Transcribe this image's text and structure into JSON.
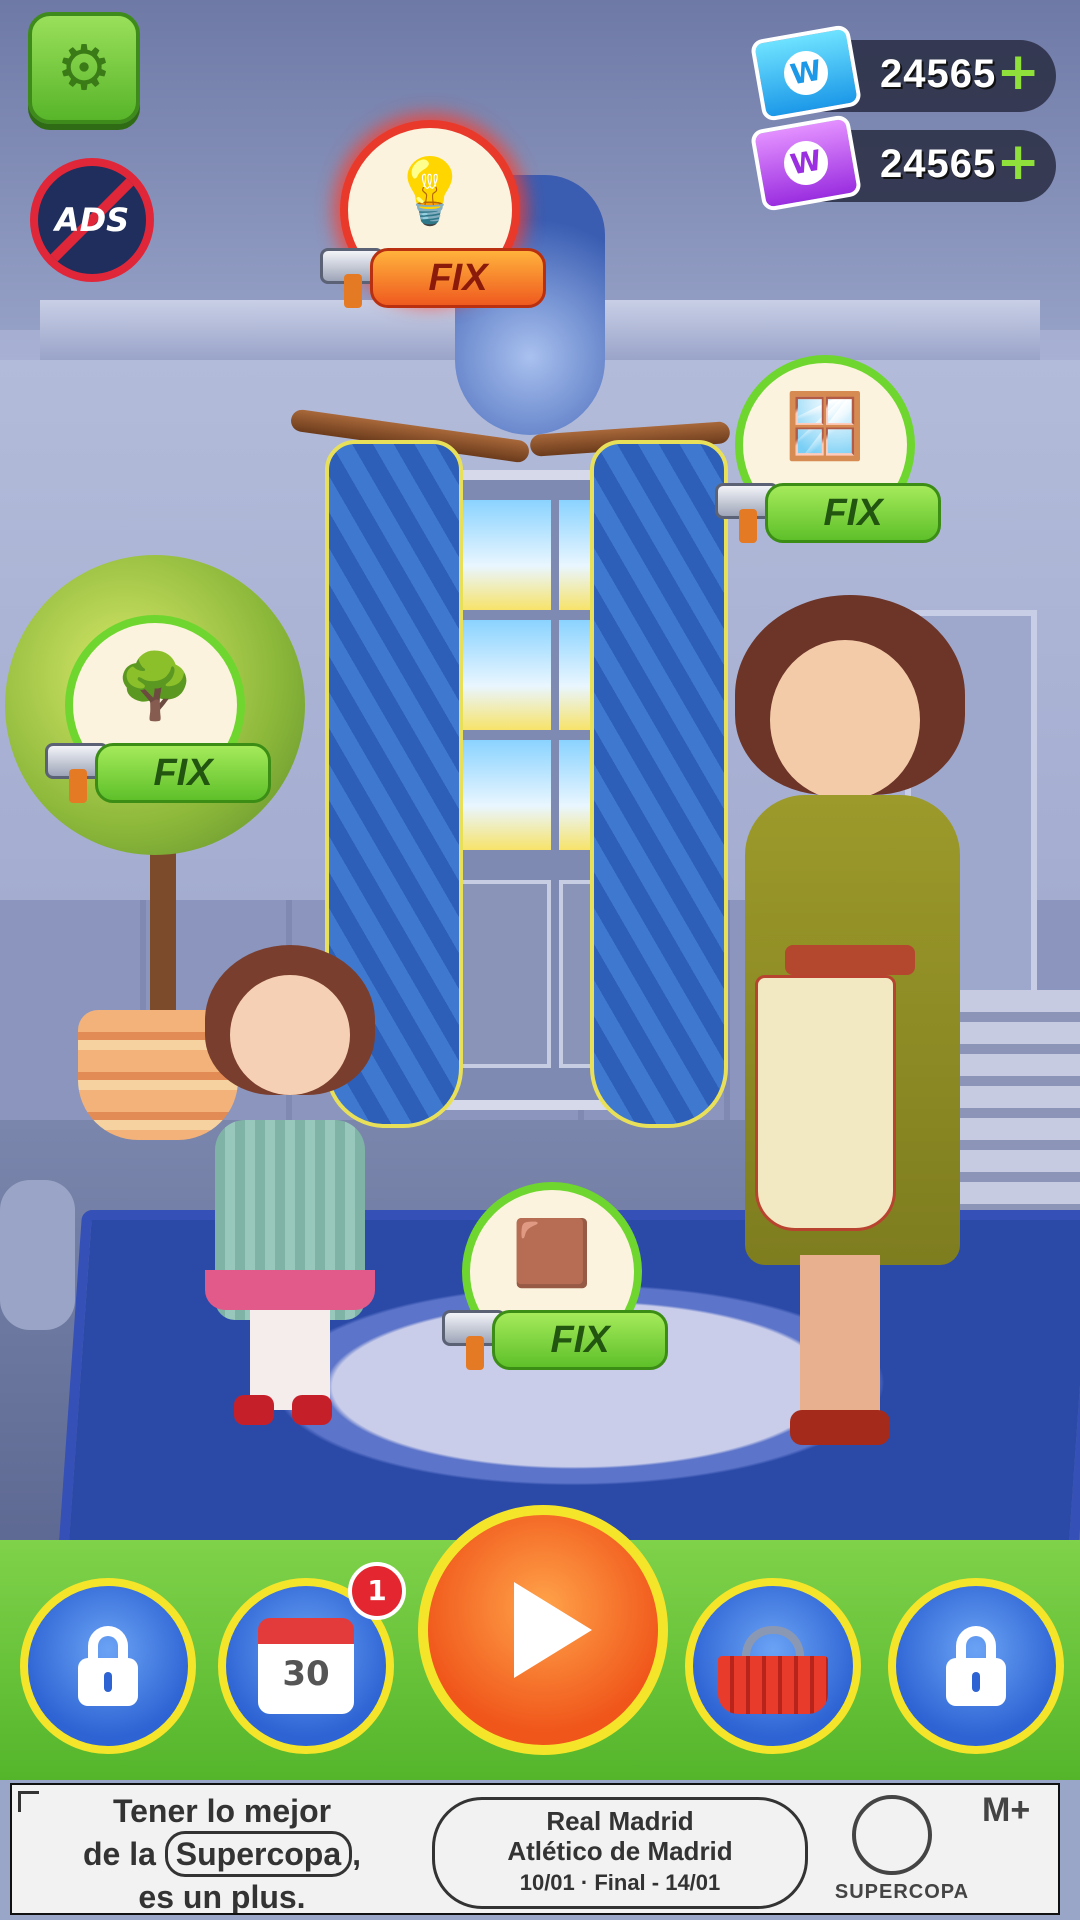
{
  "header": {
    "settings_icon": "gear-icon",
    "ads_label": "ADS",
    "currencies": [
      {
        "icon": "blue-ticket-icon",
        "letter": "W",
        "value": "24565",
        "plus": "+"
      },
      {
        "icon": "purple-ticket-icon",
        "letter": "W",
        "value": "24565",
        "plus": "+"
      }
    ]
  },
  "fix_items": [
    {
      "id": "ceiling-lamp",
      "label": "FIX",
      "state": "highlighted",
      "color": "#e8392a"
    },
    {
      "id": "curtains",
      "label": "FIX",
      "state": "normal",
      "color": "#6fd62f"
    },
    {
      "id": "tree",
      "label": "FIX",
      "state": "normal",
      "color": "#6fd62f"
    },
    {
      "id": "rug",
      "label": "FIX",
      "state": "normal",
      "color": "#6fd62f"
    }
  ],
  "bottom_bar": {
    "buttons": [
      {
        "id": "locked-left",
        "icon": "lock-icon"
      },
      {
        "id": "daily-calendar",
        "icon": "calendar-icon",
        "calendar_number": "30",
        "badge": "1"
      },
      {
        "id": "play",
        "icon": "play-icon"
      },
      {
        "id": "shop",
        "icon": "basket-icon"
      },
      {
        "id": "locked-right",
        "icon": "lock-icon"
      }
    ]
  },
  "ad_banner": {
    "line1": "Tener lo mejor",
    "line2_pre": "de la",
    "line2_pill": "Supercopa",
    "line2_post": ",",
    "line3": "es un plus.",
    "match_team1": "Real Madrid",
    "match_team2": "Atlético de Madrid",
    "match_dates": "10/01  ·  Final - 14/01",
    "brand": "SUPERCOPA",
    "partner": "M+"
  },
  "colors": {
    "accent_green": "#6fd62f",
    "accent_red": "#e8392a",
    "button_blue": "#2d63d3",
    "button_ring_yellow": "#f5e52a",
    "play_orange": "#f0561a"
  }
}
